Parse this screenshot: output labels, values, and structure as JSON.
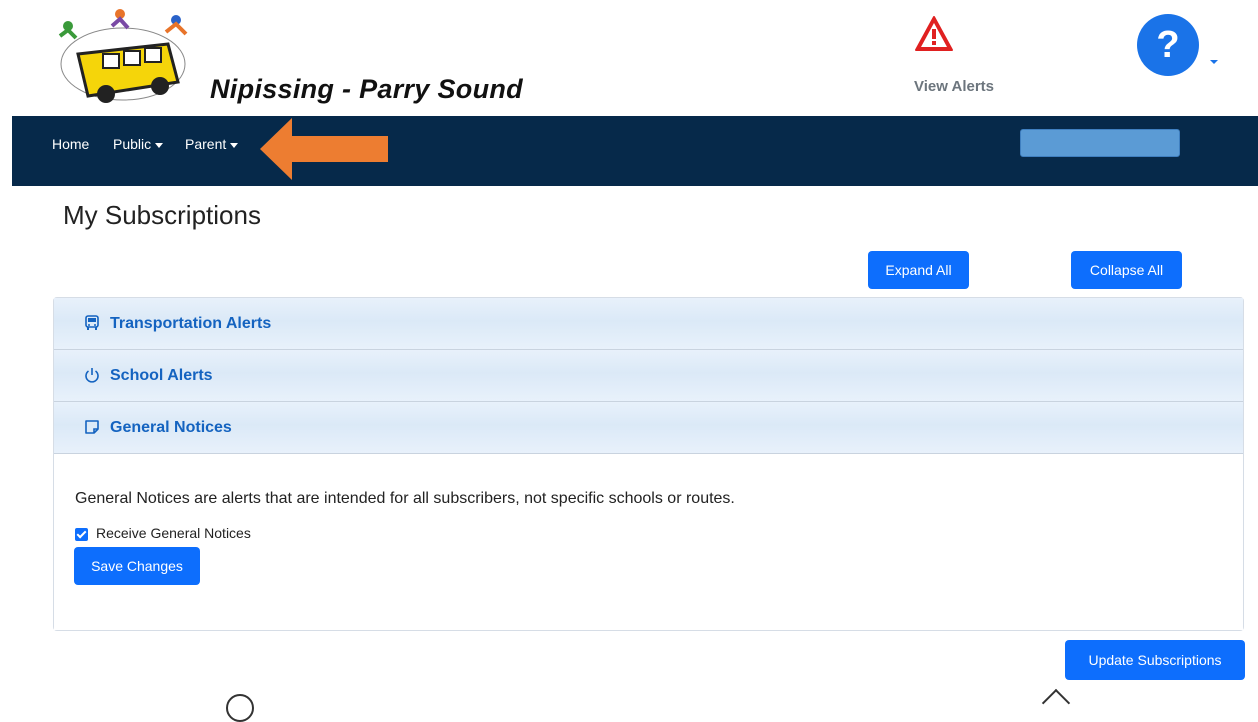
{
  "header": {
    "brand": "Nipissing - Parry Sound",
    "alerts_label": "View Alerts",
    "help_label": "?"
  },
  "nav": {
    "items": [
      {
        "label": "Home",
        "dropdown": false
      },
      {
        "label": "Public",
        "dropdown": true
      },
      {
        "label": "Parent",
        "dropdown": true
      }
    ]
  },
  "page": {
    "title": "My Subscriptions",
    "expand_all": "Expand All",
    "collapse_all": "Collapse All",
    "update": "Update Subscriptions"
  },
  "accordion": {
    "sections": [
      {
        "title": "Transportation Alerts",
        "icon": "bus-icon"
      },
      {
        "title": "School Alerts",
        "icon": "power-icon"
      },
      {
        "title": "General Notices",
        "icon": "note-icon"
      }
    ],
    "general": {
      "description": "General Notices are alerts that are intended for all subscribers, not specific schools or routes.",
      "checkbox_label": "Receive General Notices",
      "checked": true,
      "save": "Save Changes"
    }
  },
  "colors": {
    "navbar": "#06294a",
    "primary": "#0d6efd",
    "accent_arrow": "#ed7d31",
    "alert_red": "#e02020",
    "section_title": "#1463c0"
  }
}
